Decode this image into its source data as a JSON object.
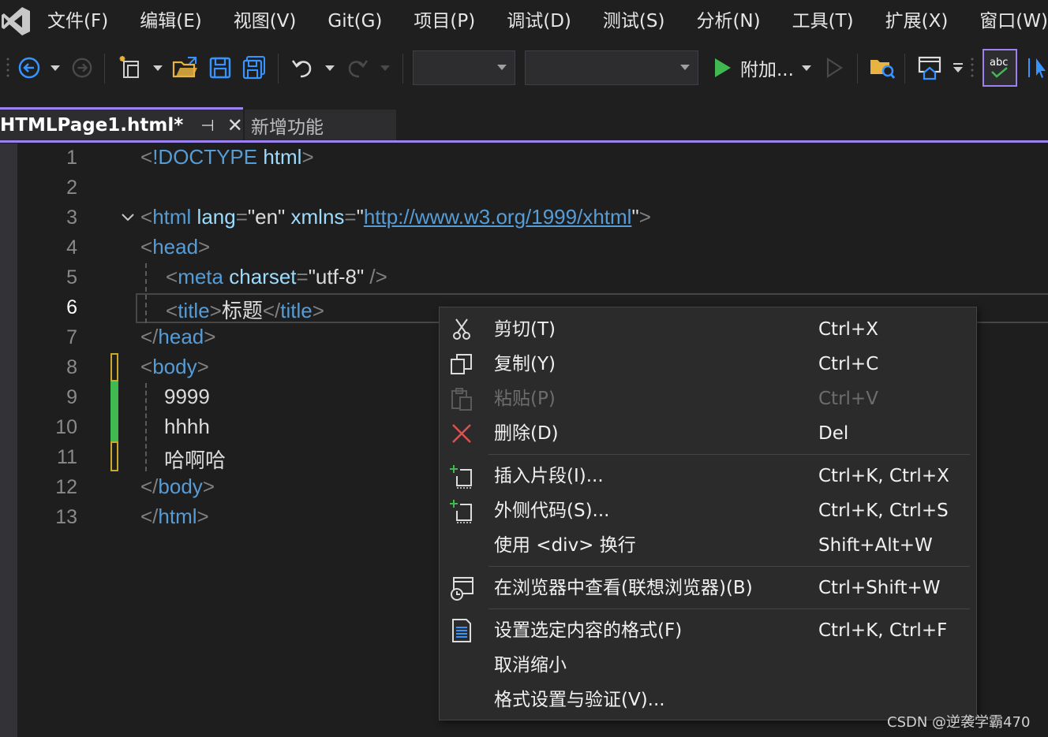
{
  "menubar": {
    "logo": "visual-studio-logo",
    "items": [
      "文件(F)",
      "编辑(E)",
      "视图(V)",
      "Git(G)",
      "项目(P)",
      "调试(D)",
      "测试(S)",
      "分析(N)",
      "工具(T)",
      "扩展(X)",
      "窗口(W)"
    ]
  },
  "toolbar": {
    "run_label": "附加...",
    "config_dropdown": "",
    "platform_dropdown": "",
    "colors": {
      "blue": "#3794ff",
      "green": "#3fb950",
      "folder": "#e8b341",
      "accent": "#9b82ef"
    }
  },
  "tabs": {
    "active": {
      "title": "HTMLPage1.html*",
      "pin": "⊣",
      "close": "✕"
    },
    "inactive": {
      "title": "新增功能"
    }
  },
  "editor": {
    "current_line": 6,
    "line_numbers": [
      "1",
      "2",
      "3",
      "4",
      "5",
      "6",
      "7",
      "8",
      "9",
      "10",
      "11",
      "12",
      "13"
    ],
    "l1": {
      "open": "<",
      "doctype": "!DOCTYPE",
      "html": "html",
      "close": ">"
    },
    "l3": {
      "open": "<",
      "tag": "html",
      "attr1": "lang",
      "eq1": "=",
      "val1": "\"en\"",
      "attr2": "xmlns",
      "eq2": "=",
      "q1": "\"",
      "url": "http://www.w3.org/1999/xhtml",
      "q2": "\"",
      "close": ">"
    },
    "l4": {
      "open": "<",
      "tag": "head",
      "close": ">"
    },
    "l5": {
      "open": "<",
      "tag": "meta",
      "attr": "charset",
      "eq": "=",
      "val": "\"utf-8\"",
      "close": " />"
    },
    "l6": {
      "open": "<",
      "tag": "title",
      "close": ">",
      "text": "标题",
      "open2": "</",
      "tag2": "title",
      "close2": ">"
    },
    "l7": {
      "open": "</",
      "tag": "head",
      "close": ">"
    },
    "l8": {
      "open": "<",
      "tag": "body",
      "close": ">"
    },
    "l9": "9999",
    "l10": "hhhh",
    "l11": "哈啊哈",
    "l12": {
      "open": "</",
      "tag": "body",
      "close": ">"
    },
    "l13": {
      "open": "</",
      "tag": "html",
      "close": ">"
    }
  },
  "context_menu": {
    "items": [
      {
        "label": "剪切(T)",
        "shortcut": "Ctrl+X",
        "icon": "scissors-icon"
      },
      {
        "label": "复制(Y)",
        "shortcut": "Ctrl+C",
        "icon": "copy-icon"
      },
      {
        "label": "粘贴(P)",
        "shortcut": "Ctrl+V",
        "icon": "paste-icon",
        "disabled": true
      },
      {
        "label": "删除(D)",
        "shortcut": "Del",
        "icon": "delete-icon"
      },
      {
        "label": "插入片段(I)...",
        "shortcut": "Ctrl+K, Ctrl+X",
        "icon": "insert-snippet-icon"
      },
      {
        "label": "外侧代码(S)...",
        "shortcut": "Ctrl+K, Ctrl+S",
        "icon": "surround-with-icon"
      },
      {
        "label": "使用 <div> 换行",
        "shortcut": "Shift+Alt+W",
        "icon": ""
      },
      {
        "label": "在浏览器中查看(联想浏览器)(B)",
        "shortcut": "Ctrl+Shift+W",
        "icon": "view-in-browser-icon"
      },
      {
        "label": "设置选定内容的格式(F)",
        "shortcut": "Ctrl+K, Ctrl+F",
        "icon": "format-selection-icon"
      },
      {
        "label": "取消缩小",
        "shortcut": "",
        "icon": ""
      },
      {
        "label": "格式设置与验证(V)...",
        "shortcut": "",
        "icon": ""
      }
    ]
  },
  "watermark": "CSDN @逆袭学霸470"
}
